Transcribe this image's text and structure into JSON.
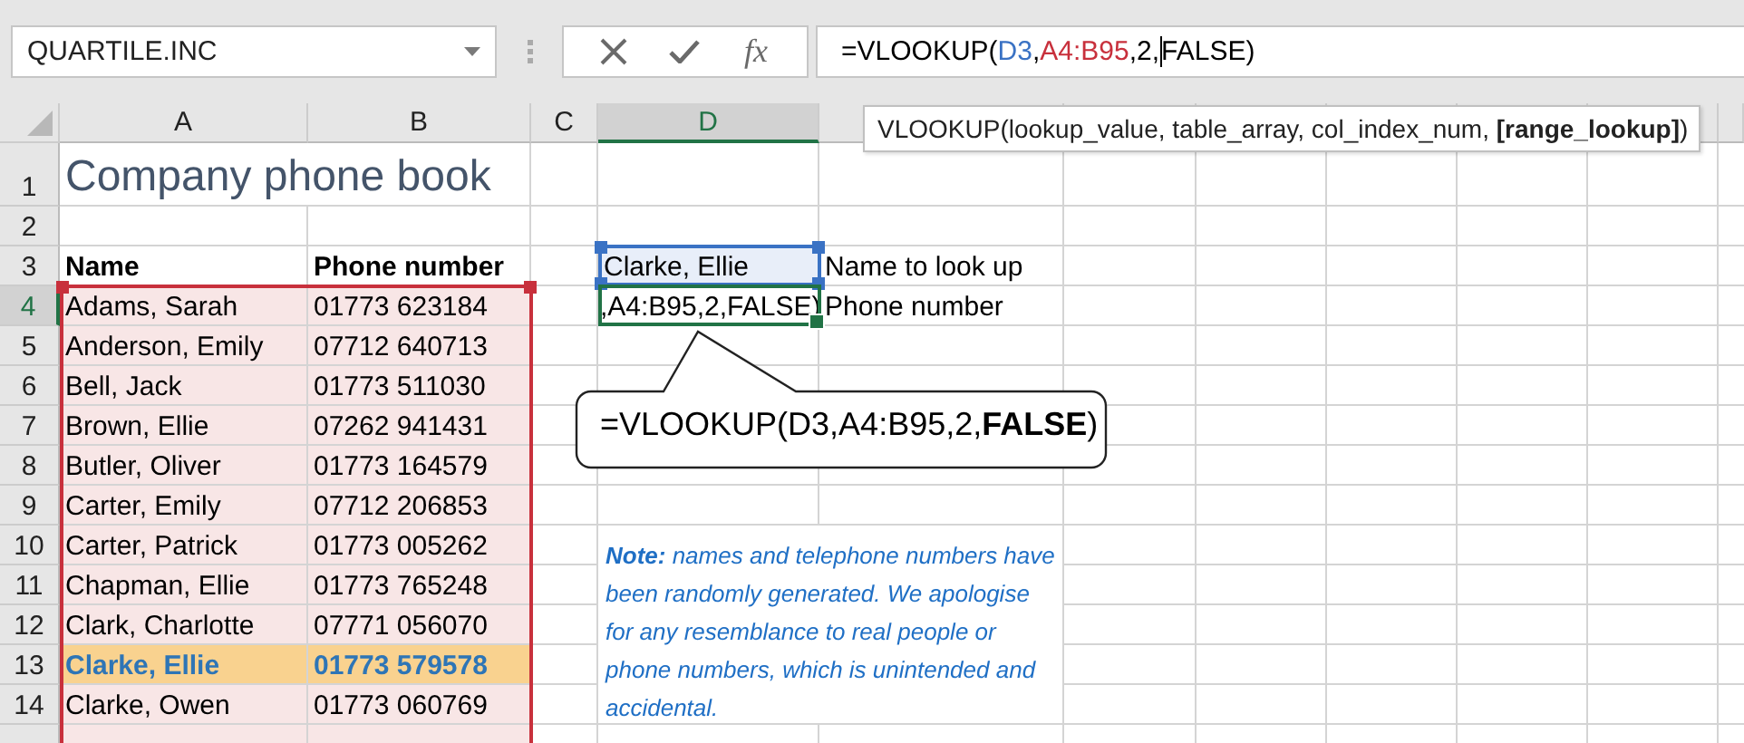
{
  "name_box": {
    "value": "QUARTILE.INC"
  },
  "formula_bar": {
    "function_label": "fx",
    "tokens": [
      {
        "text": "=VLOOKUP(",
        "color": "#000000",
        "caret": false
      },
      {
        "text": "D3",
        "color": "#3a72c4",
        "caret": false
      },
      {
        "text": ",",
        "color": "#000000",
        "caret": false
      },
      {
        "text": "A4:B95",
        "color": "#c8303c",
        "caret": false
      },
      {
        "text": ",2,",
        "color": "#000000",
        "caret": true
      },
      {
        "text": "FALSE)",
        "color": "#000000",
        "caret": false
      }
    ]
  },
  "tooltip": "VLOOKUP(lookup_value, table_array, col_index_num, **[range_lookup]**)",
  "columns": [
    {
      "label": "A",
      "selected": false
    },
    {
      "label": "B",
      "selected": false
    },
    {
      "label": "C",
      "selected": false
    },
    {
      "label": "D",
      "selected": true
    }
  ],
  "row_numbers": [
    {
      "label": "1",
      "selected": false
    },
    {
      "label": "2",
      "selected": false
    },
    {
      "label": "3",
      "selected": false
    },
    {
      "label": "4",
      "selected": true
    },
    {
      "label": "5",
      "selected": false
    },
    {
      "label": "6",
      "selected": false
    },
    {
      "label": "7",
      "selected": false
    },
    {
      "label": "8",
      "selected": false
    },
    {
      "label": "9",
      "selected": false
    },
    {
      "label": "10",
      "selected": false
    },
    {
      "label": "11",
      "selected": false
    },
    {
      "label": "12",
      "selected": false
    },
    {
      "label": "13",
      "selected": false
    },
    {
      "label": "14",
      "selected": false
    }
  ],
  "title": "Company phone book",
  "table": {
    "header": [
      "Name",
      "Phone number"
    ],
    "rows": [
      {
        "name": "Adams, Sarah",
        "phone": "01773 623184",
        "highlighted": false
      },
      {
        "name": "Anderson, Emily",
        "phone": "07712 640713",
        "highlighted": false
      },
      {
        "name": "Bell, Jack",
        "phone": "01773 511030",
        "highlighted": false
      },
      {
        "name": "Brown, Ellie",
        "phone": "07262 941431",
        "highlighted": false
      },
      {
        "name": "Butler, Oliver",
        "phone": "01773 164579",
        "highlighted": false
      },
      {
        "name": "Carter, Emily",
        "phone": "07712 206853",
        "highlighted": false
      },
      {
        "name": "Carter, Patrick",
        "phone": "01773 005262",
        "highlighted": false
      },
      {
        "name": "Chapman, Ellie",
        "phone": "01773 765248",
        "highlighted": false
      },
      {
        "name": "Clark, Charlotte",
        "phone": "07771 056070",
        "highlighted": false
      },
      {
        "name": "Clarke, Ellie",
        "phone": "01773 579578",
        "highlighted": true
      },
      {
        "name": "Clarke, Owen",
        "phone": "01773 060769",
        "highlighted": false
      }
    ]
  },
  "lookup": {
    "input": "Clarke, Ellie",
    "input_label": "Name to look up",
    "result_editing": ",A4:B95,2,FALSE)",
    "result_label": "Phone number"
  },
  "callout": "=VLOOKUP(D3,A4:B95,2,**FALSE**)",
  "note": "**Note:**  names and telephone numbers have been randomly generated. We apologise for any resemblance to real people or phone numbers, which is unintended and accidental."
}
